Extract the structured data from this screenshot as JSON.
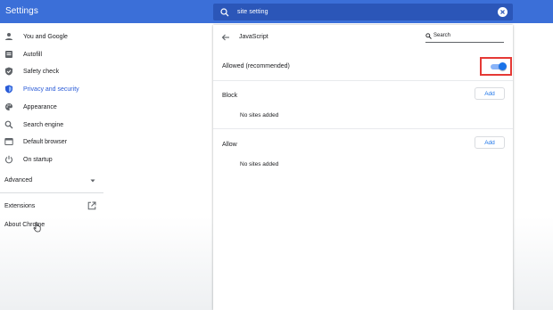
{
  "app": {
    "title": "Settings"
  },
  "search": {
    "query": "site setting"
  },
  "sidebar": {
    "items": [
      {
        "label": "You and Google",
        "icon": "person-icon"
      },
      {
        "label": "Autofill",
        "icon": "autofill-icon"
      },
      {
        "label": "Safety check",
        "icon": "shield-check-icon"
      },
      {
        "label": "Privacy and security",
        "icon": "shield-icon",
        "active": true
      },
      {
        "label": "Appearance",
        "icon": "palette-icon"
      },
      {
        "label": "Search engine",
        "icon": "search-icon"
      },
      {
        "label": "Default browser",
        "icon": "browser-icon"
      },
      {
        "label": "On startup",
        "icon": "power-icon"
      }
    ],
    "advanced_label": "Advanced",
    "extensions_label": "Extensions",
    "about_label": "About Chrome"
  },
  "page": {
    "title": "JavaScript",
    "search_placeholder": "Search",
    "allowed_label": "Allowed (recommended)",
    "allowed_enabled": true,
    "block": {
      "title": "Block",
      "add_label": "Add",
      "empty_text": "No sites added"
    },
    "allow": {
      "title": "Allow",
      "add_label": "Add",
      "empty_text": "No sites added"
    }
  },
  "colors": {
    "topbar": "#3b6fd8",
    "search_box": "#2b56b8",
    "accent": "#1a73e8",
    "active_nav": "#2a5bd7",
    "highlight": "#e53935"
  }
}
